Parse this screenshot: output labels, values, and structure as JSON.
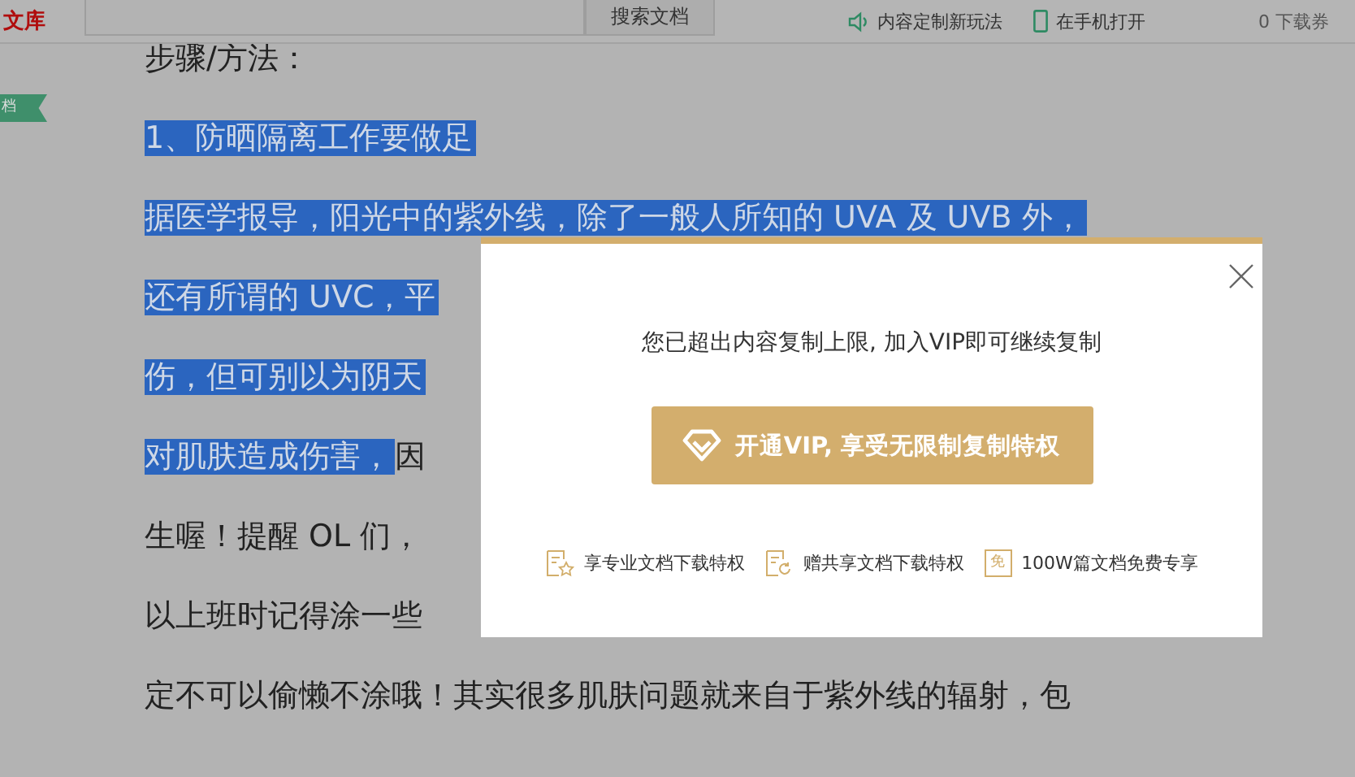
{
  "header": {
    "logo": "文库",
    "search_button": "搜索文档",
    "links": [
      {
        "kind": "speaker",
        "label": "内容定制新玩法"
      },
      {
        "kind": "phone",
        "label": "在手机打开"
      }
    ],
    "coupons": "0 下载券"
  },
  "side_tag": "档",
  "document": {
    "lines": [
      {
        "segments": [
          {
            "text": "步骤/方法：",
            "selected": false
          }
        ]
      },
      {
        "segments": [
          {
            "text": "1、防晒隔离工作要做足",
            "selected": true
          }
        ]
      },
      {
        "segments": [
          {
            "text": "据医学报导，阳光中的紫外线，除了一般人所知的 UVA 及 UVB 外，",
            "selected": true
          }
        ]
      },
      {
        "segments": [
          {
            "text": "还有所谓的 UVC，平",
            "selected": true
          }
        ]
      },
      {
        "segments": [
          {
            "text": "伤，但可别以为阴天",
            "selected": true
          }
        ]
      },
      {
        "segments": [
          {
            "text": "对肌肤造成伤害，",
            "selected": true
          },
          {
            "text": "因",
            "selected": false
          }
        ]
      },
      {
        "segments": [
          {
            "text": "生喔！提醒 OL 们，",
            "selected": false
          }
        ]
      },
      {
        "segments": [
          {
            "text": "以上班时记得涂一些",
            "selected": false
          }
        ]
      },
      {
        "segments": [
          {
            "text": "定不可以偷懒不涂哦！其实很多肌肤问题就来自于紫外线的辐射，包",
            "selected": false
          }
        ]
      }
    ]
  },
  "dialog": {
    "message": "您已超出内容复制上限, 加入VIP即可继续复制",
    "button": "开通VIP, 享受无限制复制特权",
    "features": [
      {
        "kind": "star-doc",
        "label": "享专业文档下载特权"
      },
      {
        "kind": "share-doc",
        "label": "赠共享文档下载特权"
      },
      {
        "kind": "free",
        "icon_text": "免",
        "label": "100W篇文档免费专享"
      }
    ]
  }
}
